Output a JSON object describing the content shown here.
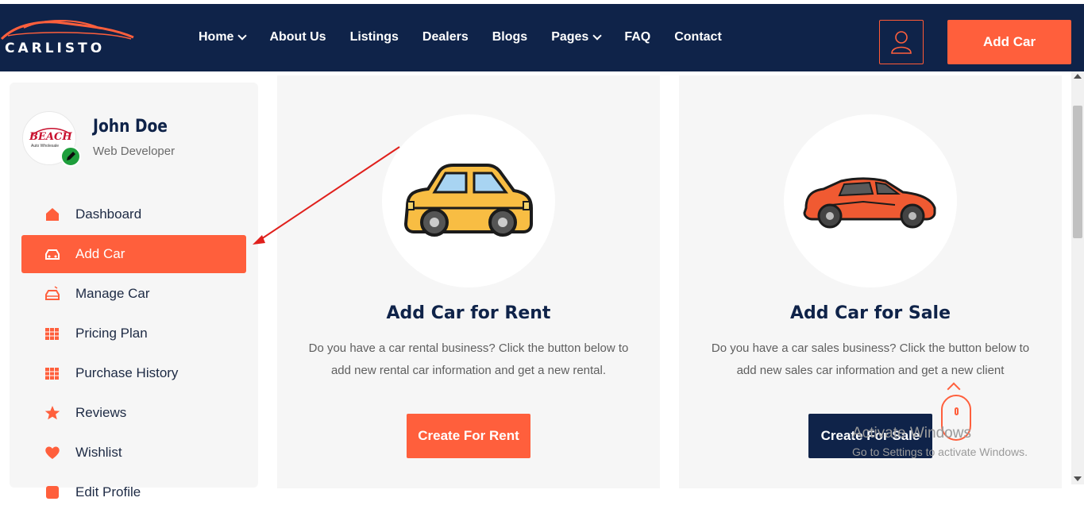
{
  "brand": {
    "name": "CARLISTO",
    "accent": "#ff5f3c",
    "navy": "#0f2349"
  },
  "nav": {
    "items": [
      {
        "label": "Home",
        "dropdown": true
      },
      {
        "label": "About Us",
        "dropdown": false
      },
      {
        "label": "Listings",
        "dropdown": false
      },
      {
        "label": "Dealers",
        "dropdown": false
      },
      {
        "label": "Blogs",
        "dropdown": false
      },
      {
        "label": "Pages",
        "dropdown": true
      },
      {
        "label": "FAQ",
        "dropdown": false
      },
      {
        "label": "Contact",
        "dropdown": false
      }
    ],
    "user_icon": "user-icon",
    "add_car_label": "Add Car"
  },
  "profile": {
    "name": "John Doe",
    "role": "Web Developer",
    "avatar_logo": "BEACH",
    "avatar_sub": "Auto Wholesale",
    "edit_icon": "pencil-icon"
  },
  "sidebar": {
    "items": [
      {
        "label": "Dashboard",
        "icon": "dashboard-icon",
        "active": false
      },
      {
        "label": "Add Car",
        "icon": "car-icon",
        "active": true
      },
      {
        "label": "Manage Car",
        "icon": "car-manage-icon",
        "active": false
      },
      {
        "label": "Pricing Plan",
        "icon": "pricing-icon",
        "active": false
      },
      {
        "label": "Purchase History",
        "icon": "history-icon",
        "active": false
      },
      {
        "label": "Reviews",
        "icon": "star-icon",
        "active": false
      },
      {
        "label": "Wishlist",
        "icon": "heart-icon",
        "active": false
      },
      {
        "label": "Edit Profile",
        "icon": "edit-profile-icon",
        "active": false
      }
    ]
  },
  "cards": {
    "rent": {
      "title": "Add Car for Rent",
      "desc": "Do you have a car rental business? Click the button below to add new rental car information and get a new rental.",
      "button": "Create For Rent",
      "icon": "yellow-car-icon"
    },
    "sale": {
      "title": "Add Car for Sale",
      "desc": "Do you have a car sales business? Click the button below to add new sales car information and get a new client",
      "button": "Create For Sale",
      "icon": "red-sports-car-icon"
    }
  },
  "watermark": {
    "line1": "Activate Windows",
    "line2": "Go to Settings to activate Windows."
  }
}
